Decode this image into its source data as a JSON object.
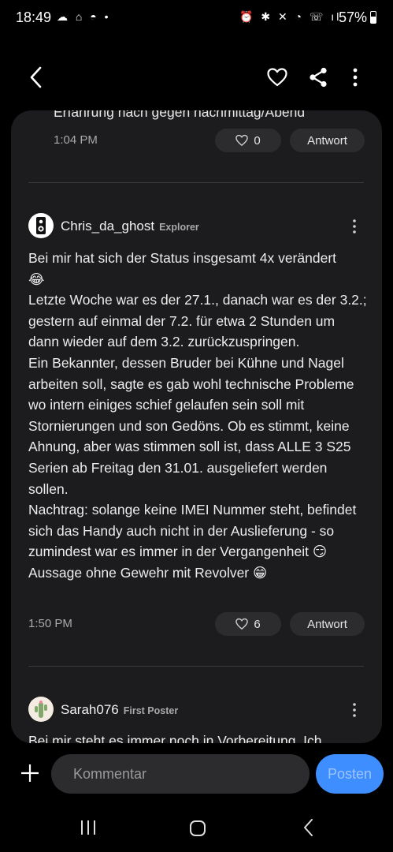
{
  "status_bar": {
    "time": "18:49",
    "left_icons": "☁ ⌂ ◓ •",
    "right_icons": "⏰ ✱ ✕ ◔ ☏ ıl",
    "battery": "57%",
    "battery_level": 0.57
  },
  "toolbar": {
    "back_icon": "chevron-left-icon",
    "heart_icon": "heart-outline-icon",
    "share_icon": "share-icon",
    "more_icon": "more-vertical-icon"
  },
  "comments": [
    {
      "partial_text": "Erfahrung nach gegen nachmittag/Abend",
      "time": "1:04 PM",
      "likes": "0",
      "reply_label": "Antwort"
    },
    {
      "author": "Chris_da_ghost",
      "rank": "Explorer",
      "text": "Bei mir hat sich der Status insgesamt 4x verändert\n😂\nLetzte Woche war es der 27.1., danach war es der 3.2.; gestern auf einmal der 7.2. für etwa 2 Stunden um dann wieder auf dem 3.2. zurückzuspringen.\nEin Bekannter, dessen Bruder bei Kühne und Nagel arbeiten soll, sagte es gab wohl technische Probleme wo intern einiges schief gelaufen sein soll mit Stornierungen und son Gedöns. Ob es stimmt, keine Ahnung, aber was stimmen soll ist, dass ALLE 3 S25 Serien ab Freitag den 31.01. ausgeliefert werden sollen.\nNachtrag: solange keine IMEI Nummer steht, befindet sich das Handy auch nicht in der Auslieferung - so zumindest war es immer in der Vergangenheit 😏\nAussage ohne Gewehr mit Revolver 😁",
      "time": "1:50 PM",
      "likes": "6",
      "reply_label": "Antwort"
    },
    {
      "author": "Sarah076",
      "rank": "First Poster",
      "partial_text": "Bei mir steht es immer noch in Vorbereitung. Ich"
    }
  ],
  "comment_bar": {
    "placeholder": "Kommentar",
    "post_label": "Posten"
  },
  "colors": {
    "background": "#000000",
    "card": "#1c1c1e",
    "pill": "#2c2c2e",
    "accent": "#3e8eff"
  }
}
